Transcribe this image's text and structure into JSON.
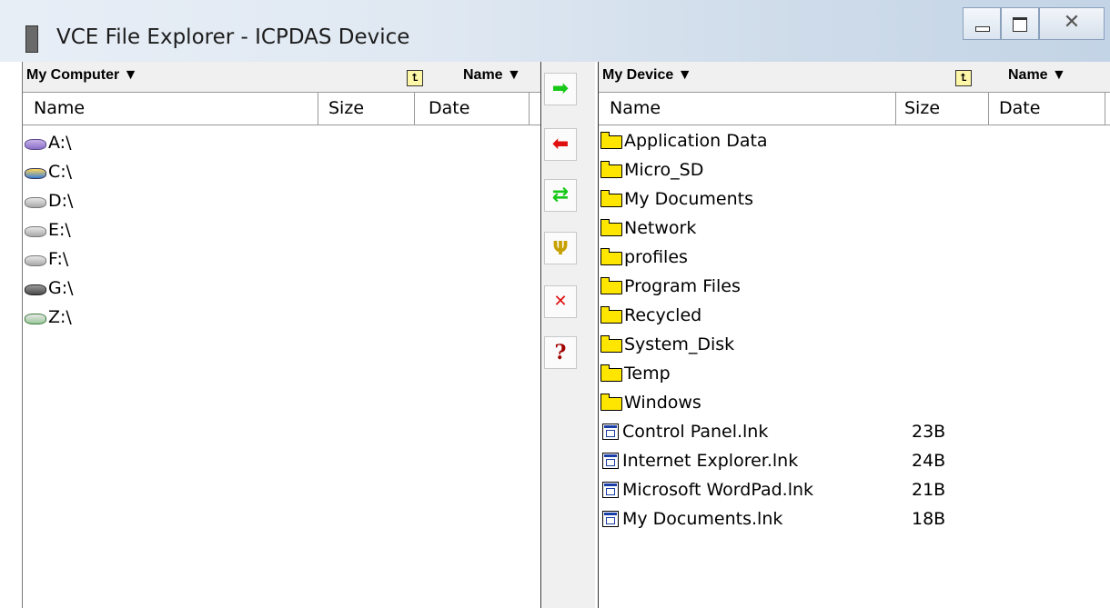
{
  "window": {
    "title": "VCE File Explorer - ICPDAS Device",
    "controls": {
      "minimize": "—",
      "maximize": "▢",
      "close": "✕"
    }
  },
  "left_pane": {
    "location": "My Computer ▼",
    "sort": "Name ▼",
    "columns": {
      "name": "Name",
      "size": "Size",
      "date": "Date"
    },
    "items": [
      {
        "name": "A:\\",
        "icon": "floppy-drive-icon"
      },
      {
        "name": "C:\\",
        "icon": "system-drive-icon"
      },
      {
        "name": "D:\\",
        "icon": "drive-icon"
      },
      {
        "name": "E:\\",
        "icon": "drive-icon"
      },
      {
        "name": "F:\\",
        "icon": "drive-icon"
      },
      {
        "name": "G:\\",
        "icon": "dvd-drive-icon"
      },
      {
        "name": "Z:\\",
        "icon": "network-drive-icon"
      }
    ]
  },
  "right_pane": {
    "location": "My Device ▼",
    "sort": "Name ▼",
    "columns": {
      "name": "Name",
      "size": "Size",
      "date": "Date"
    },
    "items": [
      {
        "name": "Application Data",
        "size": "",
        "icon": "folder-icon"
      },
      {
        "name": "Micro_SD",
        "size": "",
        "icon": "folder-icon"
      },
      {
        "name": "My Documents",
        "size": "",
        "icon": "folder-icon"
      },
      {
        "name": "Network",
        "size": "",
        "icon": "folder-icon"
      },
      {
        "name": "profiles",
        "size": "",
        "icon": "folder-icon"
      },
      {
        "name": "Program Files",
        "size": "",
        "icon": "folder-icon"
      },
      {
        "name": "Recycled",
        "size": "",
        "icon": "folder-icon"
      },
      {
        "name": "System_Disk",
        "size": "",
        "icon": "folder-icon"
      },
      {
        "name": "Temp",
        "size": "",
        "icon": "folder-icon"
      },
      {
        "name": "Windows",
        "size": "",
        "icon": "folder-icon"
      },
      {
        "name": "Control Panel.lnk",
        "size": "23B",
        "icon": "shortcut-file-icon"
      },
      {
        "name": "Internet Explorer.lnk",
        "size": "24B",
        "icon": "shortcut-file-icon"
      },
      {
        "name": "Microsoft WordPad.lnk",
        "size": "21B",
        "icon": "shortcut-file-icon"
      },
      {
        "name": "My Documents.lnk",
        "size": "18B",
        "icon": "shortcut-file-icon"
      }
    ]
  },
  "toolbar": {
    "copy_to_device": {
      "glyph": "➡",
      "color": "#18c818"
    },
    "copy_to_pc": {
      "glyph": "⬅",
      "color": "#e01010"
    },
    "sync": {
      "glyph": "⇄",
      "color": "#18c818"
    },
    "tools": {
      "glyph": "Ψ",
      "color": "#c8a000"
    },
    "delete": {
      "glyph": "✕",
      "color": "#e01010"
    },
    "help": {
      "glyph": "?",
      "color": "#a00000"
    }
  }
}
